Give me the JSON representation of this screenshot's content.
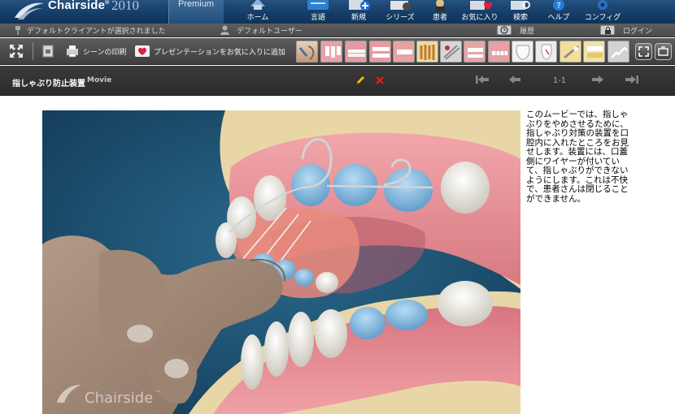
{
  "app": {
    "brand_name": "Chairside",
    "brand_mark": "®",
    "brand_year": "2010",
    "edition": "Premium",
    "watermark": "Chairside",
    "watermark_mark": "™"
  },
  "nav": [
    {
      "id": "home",
      "label": "ホーム",
      "icon": "home-icon"
    },
    {
      "id": "language",
      "label": "言語",
      "icon": "language-icon"
    },
    {
      "id": "new",
      "label": "新規",
      "icon": "new-icon"
    },
    {
      "id": "series",
      "label": "シリーズ",
      "icon": "series-icon"
    },
    {
      "id": "patient",
      "label": "患者",
      "icon": "patient-icon"
    },
    {
      "id": "favorites",
      "label": "お気に入り",
      "icon": "favorites-icon"
    },
    {
      "id": "search",
      "label": "検索",
      "icon": "search-icon"
    },
    {
      "id": "help",
      "label": "ヘルプ",
      "icon": "help-icon"
    },
    {
      "id": "config",
      "label": "コンフィグ",
      "icon": "config-icon"
    }
  ],
  "status": {
    "client": "デフォルトクライアントが選択されました",
    "user": "デフォルトユーザー",
    "history": "履歴",
    "login": "ログイン"
  },
  "toolbar": {
    "print_scene": "シーンの印刷",
    "add_favorite": "プレゼンテーションをお気に入りに追加"
  },
  "scene": {
    "title": "指しゃぶり防止装置",
    "type": "Movie",
    "page": "1-1"
  },
  "description": "このムービーでは、指しゃぶりをやめさせるために、指しゃぶり対策の装置を口腔内に入れたところをお見せします。装置には、口蓋側にワイヤーが付いていて、指しゃぶりができないようにします。これは不快で、患者さんは閉じることができません。",
  "colors": {
    "header_blue": "#1a4570",
    "toolbar_gray": "#4a4a4a",
    "titlebar_dark": "#2f2f2f",
    "edit_pencil": "#f2c200",
    "delete_x": "#e02020",
    "tooth_blue": "#7ab6de",
    "gum_pink": "#e8959a"
  }
}
